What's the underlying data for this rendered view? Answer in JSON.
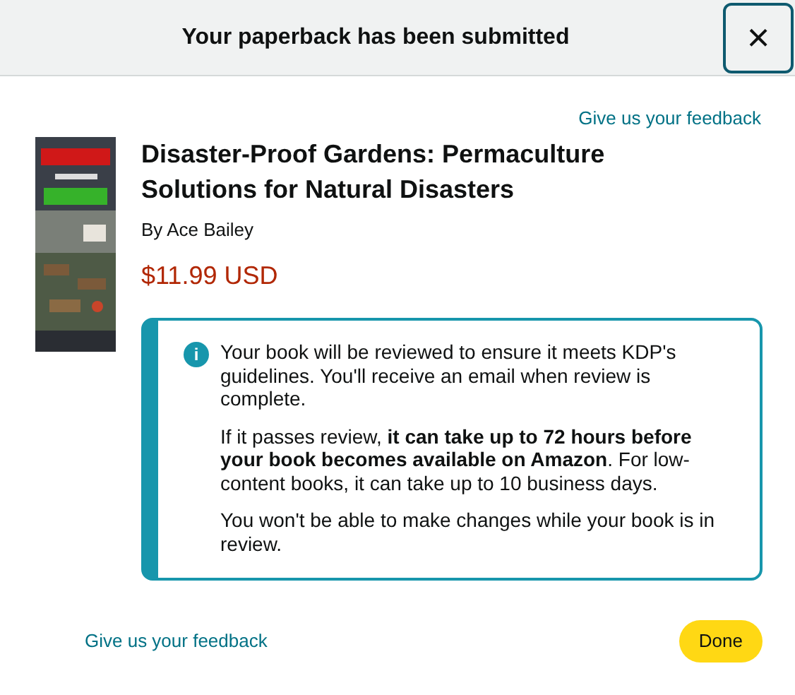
{
  "dialog": {
    "title": "Your paperback has been submitted",
    "close": "×"
  },
  "top_feedback_link": "Give us your feedback",
  "book": {
    "title": "Disaster-Proof Gardens: Permaculture Solutions for Natural Disasters",
    "author": "By Ace Bailey",
    "price": "$11.99 USD"
  },
  "notice": {
    "icon": "i",
    "paragraphs": [
      "Your book will be reviewed to ensure it meets KDP's guidelines. You'll receive an email when review is complete.",
      "If it passes review, **it can take up to 72 hours before your book becomes available on Amazon**. For low-content books, it can take up to 10 business days.",
      "You won't be able to make changes while your book is in review."
    ]
  },
  "footer": {
    "feedback_link": "Give us your feedback",
    "done_button": "Done"
  }
}
